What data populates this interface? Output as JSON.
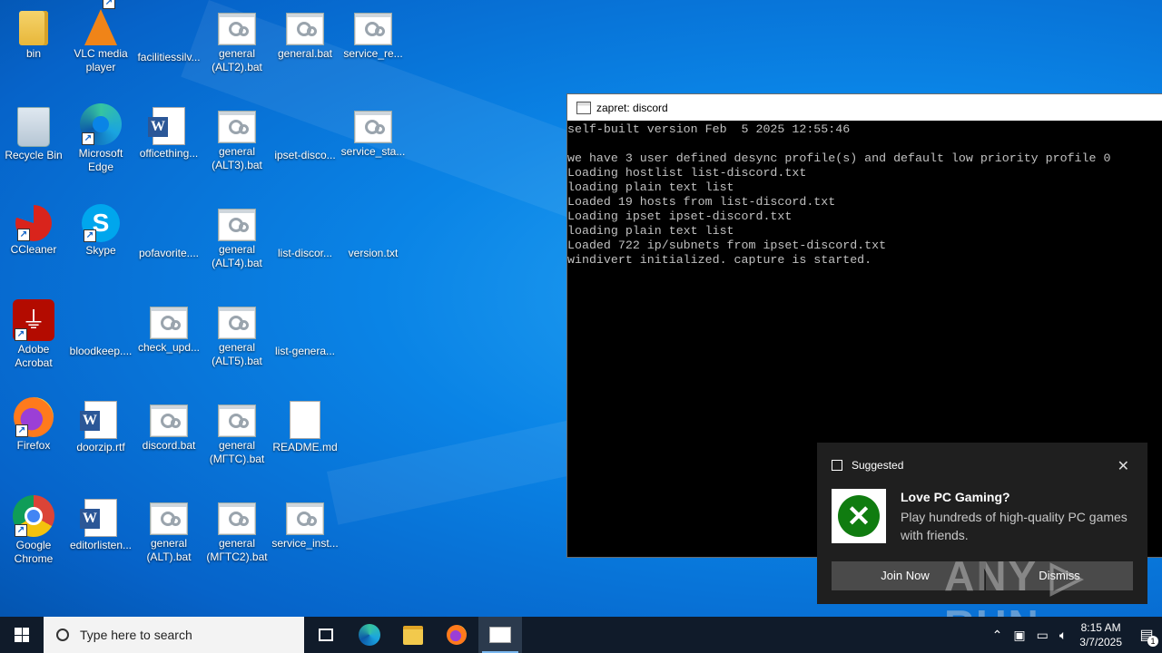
{
  "desktop": {
    "icons": [
      {
        "label": "bin",
        "type": "folder"
      },
      {
        "label": "VLC media player",
        "type": "vlc"
      },
      {
        "label": "facilitiessilv...",
        "type": "image"
      },
      {
        "label": "general (ALT2).bat",
        "type": "bat"
      },
      {
        "label": "general.bat",
        "type": "bat"
      },
      {
        "label": "service_re...",
        "type": "bat"
      },
      {
        "label": "Recycle Bin",
        "type": "recycle"
      },
      {
        "label": "Microsoft Edge",
        "type": "edge"
      },
      {
        "label": "officething...",
        "type": "word"
      },
      {
        "label": "general (ALT3).bat",
        "type": "bat"
      },
      {
        "label": "ipset-disco...",
        "type": "text"
      },
      {
        "label": "service_sta...",
        "type": "bat"
      },
      {
        "label": "CCleaner",
        "type": "ccleaner"
      },
      {
        "label": "Skype",
        "type": "skype"
      },
      {
        "label": "pofavorite....",
        "type": "image"
      },
      {
        "label": "general (ALT4).bat",
        "type": "bat"
      },
      {
        "label": "list-discor...",
        "type": "text"
      },
      {
        "label": "version.txt",
        "type": "text"
      },
      {
        "label": "Adobe Acrobat",
        "type": "acrobat"
      },
      {
        "label": "bloodkeep....",
        "type": "image"
      },
      {
        "label": "check_upd...",
        "type": "bat"
      },
      {
        "label": "general (ALT5).bat",
        "type": "bat"
      },
      {
        "label": "list-genera...",
        "type": "text"
      },
      {
        "label": "Firefox",
        "type": "firefox"
      },
      {
        "label": "doorzip.rtf",
        "type": "word"
      },
      {
        "label": "discord.bat",
        "type": "bat"
      },
      {
        "label": "general (МГТС).bat",
        "type": "bat"
      },
      {
        "label": "README.md",
        "type": "blank"
      },
      {
        "label": "Google Chrome",
        "type": "chrome"
      },
      {
        "label": "editorlisten...",
        "type": "word"
      },
      {
        "label": "general (ALT).bat",
        "type": "bat"
      },
      {
        "label": "general (МГТС2).bat",
        "type": "bat"
      },
      {
        "label": "service_inst...",
        "type": "bat"
      }
    ]
  },
  "console": {
    "title": "zapret: discord",
    "lines": [
      "self-built version Feb  5 2025 12:55:46",
      "",
      "we have 3 user defined desync profile(s) and default low priority profile 0",
      "Loading hostlist list-discord.txt",
      "loading plain text list",
      "Loaded 19 hosts from list-discord.txt",
      "Loading ipset ipset-discord.txt",
      "loading plain text list",
      "Loaded 722 ip/subnets from ipset-discord.txt",
      "windivert initialized. capture is started."
    ]
  },
  "toast": {
    "header": "Suggested",
    "close": "✕",
    "title": "Love PC Gaming?",
    "body": "Play hundreds of high-quality PC games with friends.",
    "join_label": "Join Now",
    "dismiss_label": "Dismiss"
  },
  "watermark": "ANY ▷ RUN",
  "taskbar": {
    "search_placeholder": "Type here to search",
    "time": "8:15 AM",
    "date": "3/7/2025",
    "notification_count": "1"
  }
}
